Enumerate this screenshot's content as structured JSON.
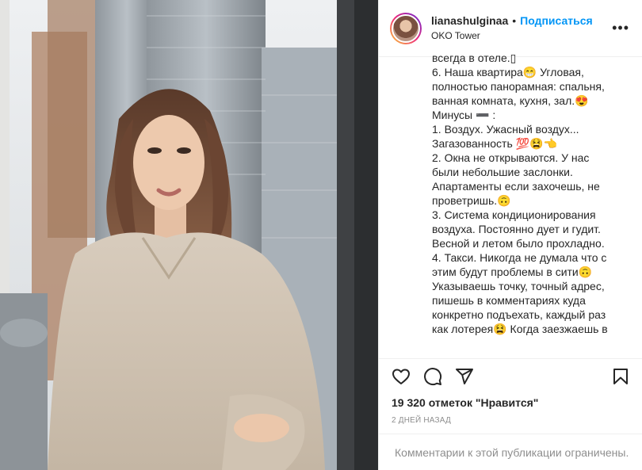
{
  "header": {
    "username": "lianashulginaa",
    "dot": "•",
    "follow_label": "Подписаться",
    "location": "OKO Tower",
    "more": "•••"
  },
  "caption": {
    "lines": [
      "всегда в отеле.▯",
      "6. Наша квартира😁 Угловая, полностью панорамная: спальня, ванная комната, кухня, зал.😍",
      "",
      "Минусы ➖ :",
      "",
      "1. Воздух. Ужасный воздух... Загазованность 💯😫👈",
      "2. Окна не открываются. У нас были небольшие заслонки. Апартаменты если захочешь, не проветришь.🙃",
      "3. Система кондиционирования воздуха. Постоянно дует и гудит. Весной и летом было прохладно.",
      "4. Такси. Никогда не думала что с этим будут проблемы в сити🙃 Указываешь точку, точный адрес, пишешь в комментариях куда конкретно подъехать, каждый раз как лотерея😫 Когда заезжаешь в"
    ]
  },
  "actions": {
    "like_icon": "heart-outline-icon",
    "comment_icon": "comment-bubble-icon",
    "share_icon": "paper-plane-icon",
    "save_icon": "bookmark-icon"
  },
  "likes_text": "19 320 отметок \"Нравится\"",
  "date_text": "2 ДНЕЙ НАЗАД",
  "comments_text": "Комментарии к этой публикации ограничены.",
  "colors": {
    "accent": "#0095f6",
    "text": "#262626",
    "muted": "#8e8e8e",
    "border": "#efefef"
  }
}
